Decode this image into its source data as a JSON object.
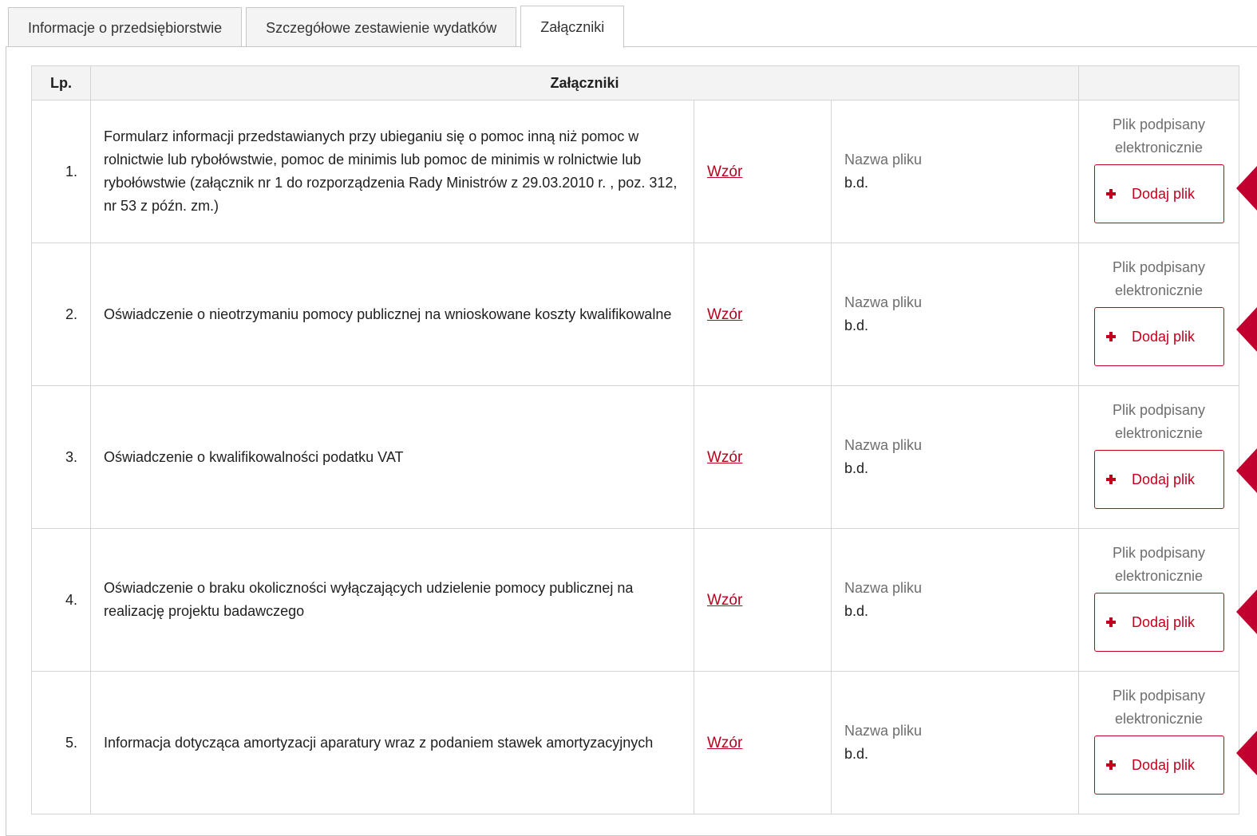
{
  "tabs": [
    {
      "label": "Informacje o przedsiębiorstwie",
      "active": false
    },
    {
      "label": "Szczegółowe zestawienie wydatków",
      "active": false
    },
    {
      "label": "Załączniki",
      "active": true
    }
  ],
  "table": {
    "headers": {
      "lp": "Lp.",
      "attachments": "Załączniki",
      "action": ""
    },
    "rows": [
      {
        "lp": "1.",
        "description": "Formularz informacji przedstawianych przy ubieganiu się o pomoc inną niż pomoc w rolnictwie lub rybołówstwie, pomoc de minimis lub pomoc de minimis w rolnictwie lub rybołówstwie (załącznik nr 1 do rozporządzenia Rady Ministrów z 29.03.2010 r. , poz. 312, nr 53 z późn. zm.)",
        "sample_link": "Wzór",
        "file_label": "Nazwa pliku",
        "file_value": "b.d.",
        "signed_label": "Plik podpisany elektronicznie",
        "add_label": "Dodaj plik"
      },
      {
        "lp": "2.",
        "description": "Oświadczenie o nieotrzymaniu pomocy publicznej na wnioskowane koszty kwalifikowalne",
        "sample_link": "Wzór",
        "file_label": "Nazwa pliku",
        "file_value": "b.d.",
        "signed_label": "Plik podpisany elektronicznie",
        "add_label": "Dodaj plik"
      },
      {
        "lp": "3.",
        "description": "Oświadczenie o kwalifikowalności podatku VAT",
        "sample_link": "Wzór",
        "file_label": "Nazwa pliku",
        "file_value": "b.d.",
        "signed_label": "Plik podpisany elektronicznie",
        "add_label": "Dodaj plik"
      },
      {
        "lp": "4.",
        "description": "Oświadczenie o braku okoliczności wyłączających udzielenie pomocy publicznej na realizację projektu badawczego",
        "sample_link": "Wzór",
        "file_label": "Nazwa pliku",
        "file_value": "b.d.",
        "signed_label": "Plik podpisany elektronicznie",
        "add_label": "Dodaj plik"
      },
      {
        "lp": "5.",
        "description": "Informacja dotycząca amortyzacji aparatury wraz z podaniem stawek amortyzacyjnych",
        "sample_link": "Wzór",
        "file_label": "Nazwa pliku",
        "file_value": "b.d.",
        "signed_label": "Plik podpisany elektronicznie",
        "add_label": "Dodaj plik"
      }
    ]
  },
  "colors": {
    "accent": "#c1001e",
    "marker": "#c1002f",
    "header_bg": "#f3f3f3",
    "border": "#d4d4d4"
  },
  "icons": {
    "add": "plus-icon",
    "marker": "pointer-marker-icon"
  }
}
